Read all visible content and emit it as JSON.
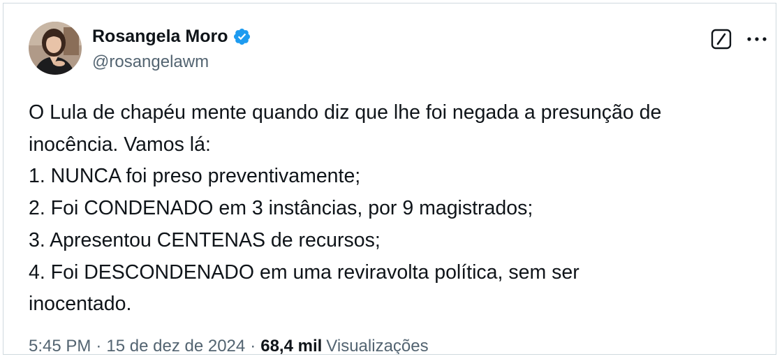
{
  "author": {
    "display_name": "Rosangela Moro",
    "handle": "@rosangelawm",
    "verified": true,
    "verified_color": "#1d9bf0"
  },
  "tweet": {
    "lines": [
      "O Lula de chapéu mente quando diz que lhe foi negada a presunção de",
      "inocência. Vamos lá:",
      "1. NUNCA foi preso preventivamente;",
      "2. Foi CONDENADO em 3 instâncias, por 9 magistrados;",
      "3. Apresentou CENTENAS de recursos;",
      "4. Foi DESCONDENADO em uma reviravolta política, sem ser",
      "inocentado."
    ]
  },
  "meta": {
    "time": "5:45 PM",
    "separator": "·",
    "date": "15 de dez de 2024",
    "views_count": "68,4 mil",
    "views_label": "Visualizações"
  },
  "actions": {
    "grok_icon": "grok-icon",
    "more_icon": "more-icon"
  },
  "colors": {
    "text_primary": "#0f1419",
    "text_secondary": "#536471",
    "border": "#cfd9de"
  }
}
